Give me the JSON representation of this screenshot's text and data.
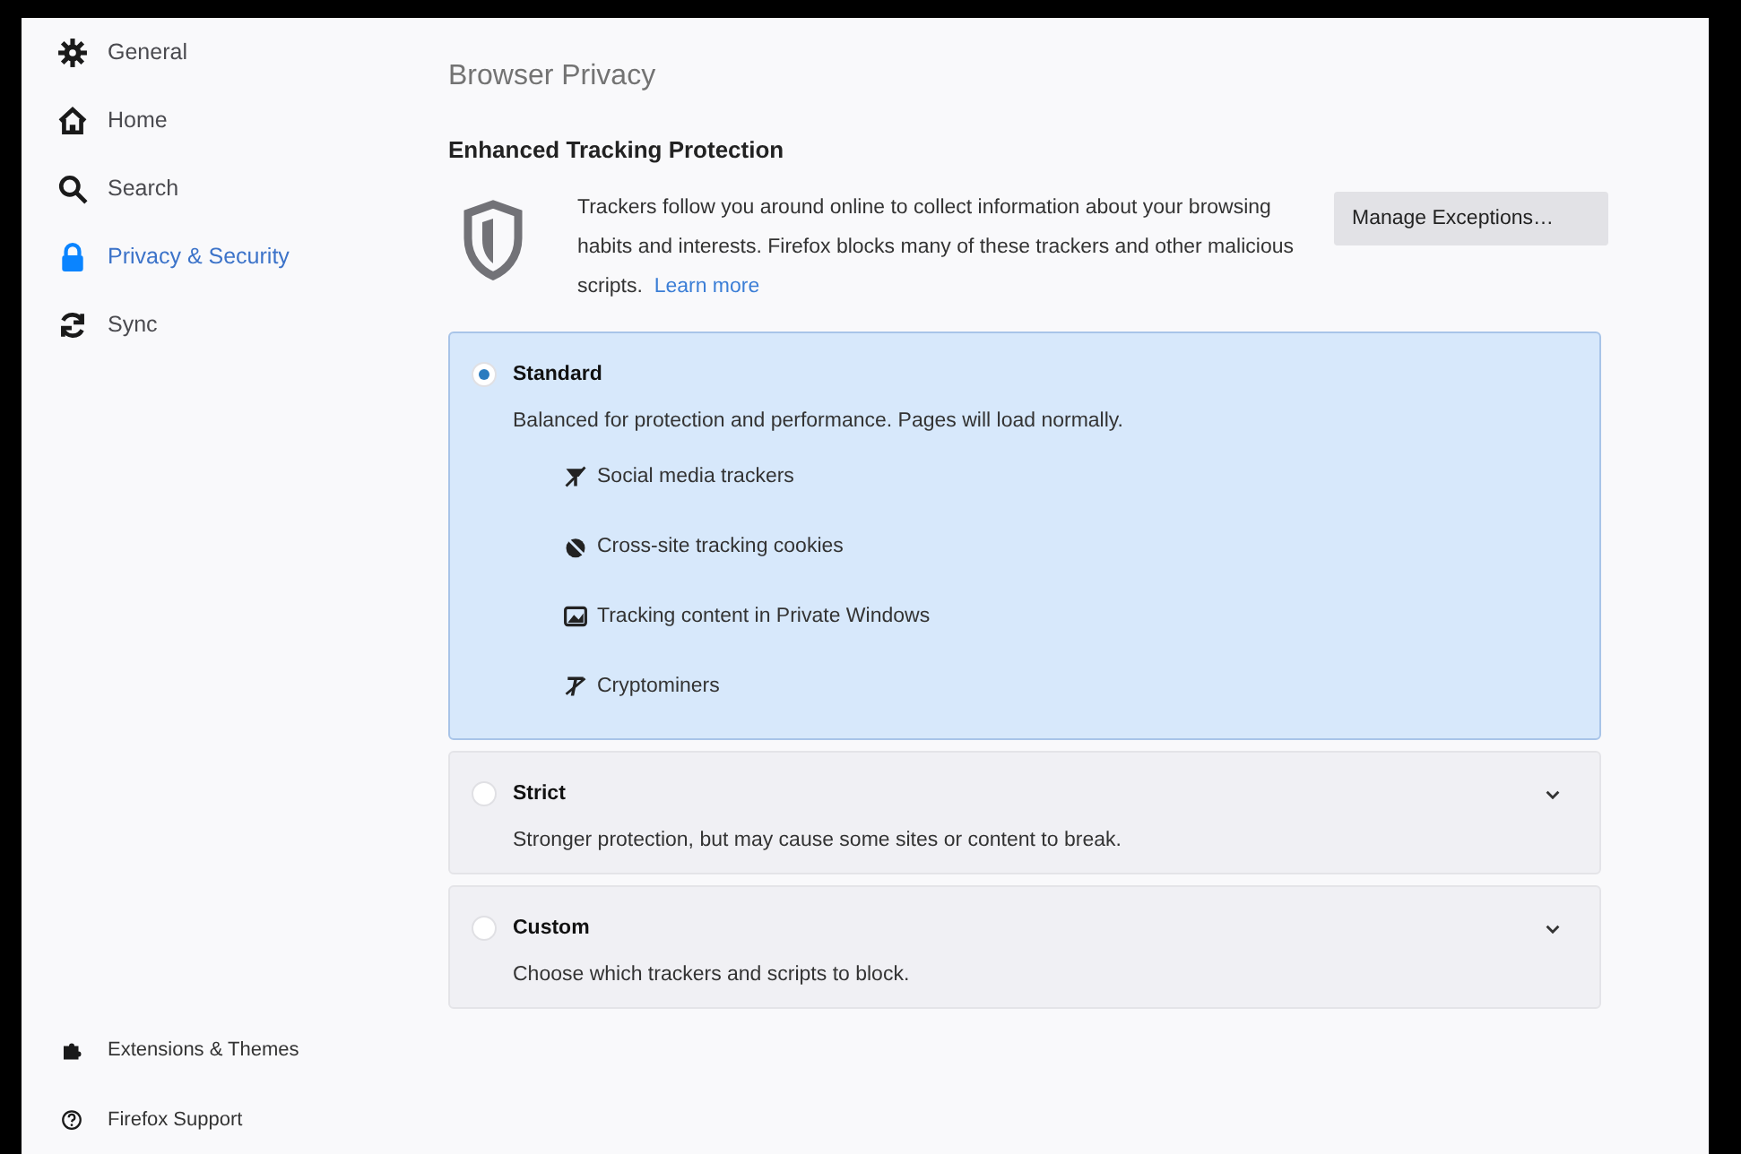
{
  "sidebar": {
    "items": [
      {
        "label": "General",
        "selected": false
      },
      {
        "label": "Home",
        "selected": false
      },
      {
        "label": "Search",
        "selected": false
      },
      {
        "label": "Privacy & Security",
        "selected": true
      },
      {
        "label": "Sync",
        "selected": false
      }
    ],
    "footer_links": [
      "Extensions & Themes",
      "Firefox Support"
    ]
  },
  "page_title": "Browser Privacy",
  "section": {
    "heading": "Enhanced Tracking Protection",
    "description": "Trackers follow you around online to collect information about your browsing habits and interests. Firefox blocks many of these trackers and other malicious scripts.",
    "learn_more": "Learn more",
    "button": "Manage Exceptions…"
  },
  "options": [
    {
      "label": "Standard",
      "description": "Balanced for protection and performance. Pages will load normally.",
      "selected": true,
      "expanded": true,
      "items": [
        "Social media trackers",
        "Cross-site tracking cookies",
        "Tracking content in Private Windows",
        "Cryptominers"
      ]
    },
    {
      "label": "Strict",
      "description": "Stronger protection, but may cause some sites or content to break.",
      "selected": false,
      "expanded": false
    },
    {
      "label": "Custom",
      "description": "Choose which trackers and scripts to block.",
      "selected": false,
      "expanded": false
    }
  ]
}
